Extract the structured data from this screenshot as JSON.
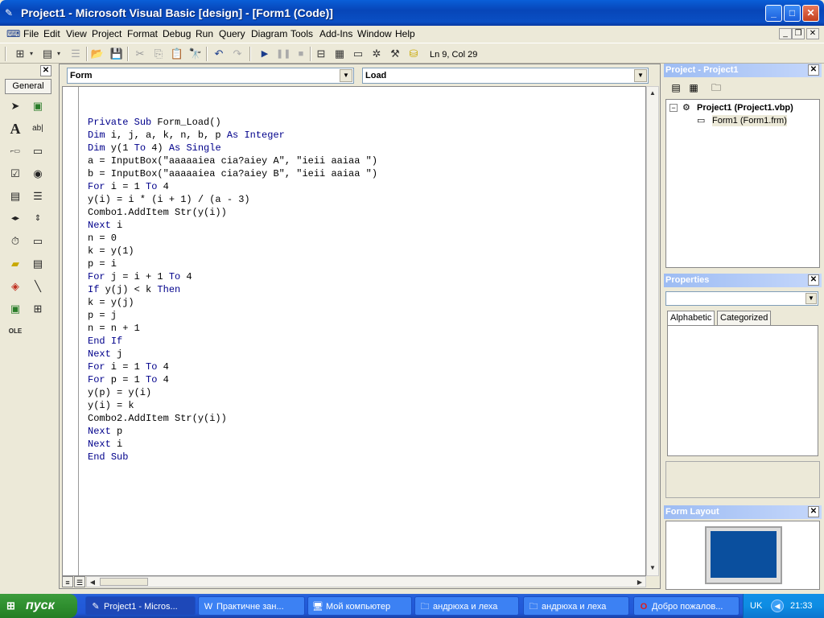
{
  "window": {
    "title": "Project1 - Microsoft Visual Basic [design] - [Form1 (Code)]",
    "minimize": "_",
    "maximize": "□",
    "close": "✕"
  },
  "menu": {
    "items": [
      "File",
      "Edit",
      "View",
      "Project",
      "Format",
      "Debug",
      "Run",
      "Query",
      "Diagram",
      "Tools",
      "Add-Ins",
      "Window",
      "Help"
    ],
    "mdi_minimize": "_",
    "mdi_restore": "❐",
    "mdi_close": "✕"
  },
  "toolbar": {
    "position": "Ln 9, Col 29"
  },
  "toolbox": {
    "close": "✕",
    "tab": "General"
  },
  "code": {
    "object_combo": "Form",
    "procedure_combo": "Load",
    "lines": [
      "Private Sub Form_Load()",
      "Dim i, j, a, k, n, b, p As Integer",
      "Dim y(1 To 4) As Single",
      "a = InputBox(\"aaaaaiea cia?aiey A\", \"ieii aaiaa \")",
      "b = InputBox(\"aaaaaiea cia?aiey B\", \"ieii aaiaa \")",
      "For i = 1 To 4",
      "y(i) = i * (i + 1) / (a - 3)",
      "Combo1.AddItem Str(y(i))",
      "Next i",
      "n = 0",
      "k = y(1)",
      "p = i",
      "For j = i + 1 To 4",
      "If y(j) < k Then",
      "k = y(j)",
      "p = j",
      "n = n + 1",
      "End If",
      "Next j",
      "For i = 1 To 4",
      "For p = 1 To 4",
      "y(p) = y(i)",
      "y(i) = k",
      "Combo2.AddItem Str(y(i))",
      "Next p",
      "Next i",
      "End Sub"
    ]
  },
  "project_panel": {
    "title": "Project - Project1",
    "close": "✕",
    "root": "Project1 (Project1.vbp)",
    "child": "Form1 (Form1.frm)",
    "expander": "−"
  },
  "properties_panel": {
    "title": "Properties",
    "close": "✕",
    "tabs": [
      "Alphabetic",
      "Categorized"
    ]
  },
  "form_layout_panel": {
    "title": "Form Layout",
    "close": "✕"
  },
  "taskbar": {
    "start": "пуск",
    "tasks": [
      {
        "label": "Project1 - Micros...",
        "icon": "vb-icon"
      },
      {
        "label": "Практичне зан...",
        "icon": "word-icon"
      },
      {
        "label": "Мой компьютер",
        "icon": "computer-icon"
      },
      {
        "label": "андрюха и леха",
        "icon": "folder-icon"
      },
      {
        "label": "андрюха и леха",
        "icon": "folder-icon"
      },
      {
        "label": "Добро пожалов...",
        "icon": "opera-icon"
      }
    ],
    "lang": "UK",
    "clock": "21:33"
  },
  "colors": {
    "keyword": "#00008b",
    "titlebar": "#0a5fd8",
    "taskbar": "#245edb",
    "start": "#2f8f2f"
  }
}
